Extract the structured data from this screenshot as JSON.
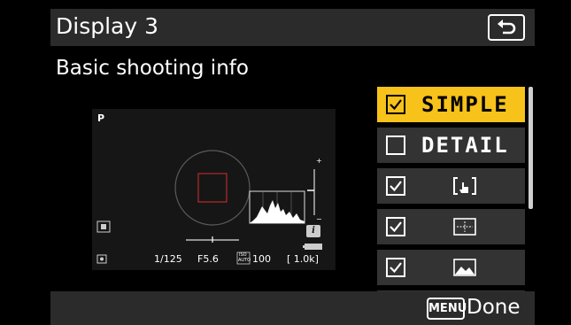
{
  "header": {
    "title": "Display 3"
  },
  "subtitle": "Basic shooting info",
  "preview": {
    "mode": "P",
    "shutter": "1/125",
    "aperture": "F5.6",
    "iso_top": "ISO",
    "iso_bottom": "AUTO",
    "iso_value": "100",
    "frames_remaining": "[ 1.0k]",
    "info_button": "i"
  },
  "menu": {
    "items": [
      {
        "label": "SIMPLE",
        "checked": true,
        "selected": true
      },
      {
        "label": "DETAIL",
        "checked": false,
        "selected": false
      },
      {
        "icon": "touch-shutter-icon",
        "checked": true,
        "selected": false
      },
      {
        "icon": "framing-grid-icon",
        "checked": true,
        "selected": false
      },
      {
        "icon": "landscape-image-icon",
        "checked": true,
        "selected": false
      }
    ]
  },
  "footer": {
    "menu_badge": "MENU",
    "done_label": "Done"
  },
  "colors": {
    "highlight": "#f7c21a",
    "bar": "#2b2b2b",
    "focus_frame": "#b62a2a"
  }
}
